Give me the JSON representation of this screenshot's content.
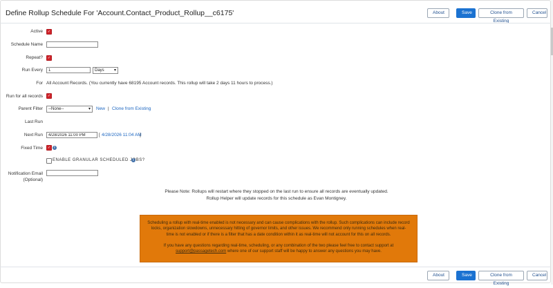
{
  "page": {
    "title": "Define Rollup Schedule For 'Account.Contact_Product_Rollup__c6175'"
  },
  "buttons": {
    "about": "About",
    "save": "Save",
    "clone": "Clone from Existing",
    "cancel": "Cancel"
  },
  "form": {
    "active_label": "Active",
    "schedule_name_label": "Schedule Name",
    "schedule_name_value": "",
    "repeat_label": "Repeat?",
    "run_every_label": "Run Every",
    "run_every_value": "1",
    "run_every_unit": "Days",
    "for_label": "For",
    "for_value": "All Account Records.  (You currently have 68195 Account records. This rollup will take 2 days 11 hours to process.)",
    "run_all_label": "Run for all records",
    "parent_filter_label": "Parent Filter",
    "parent_filter_value": "--None--",
    "parent_filter_new": "New",
    "parent_filter_divider": "|",
    "parent_filter_clone": "Clone from Existing",
    "last_run_label": "Last Run",
    "next_run_label": "Next Run",
    "next_run_value": "4/28/2026 11:00 PM",
    "next_run_bracket_open": "[",
    "next_run_link": "4/28/2026 11:04 AM",
    "next_run_bracket_close": "]",
    "fixed_time_label": "Fixed Time",
    "granular_label": "ENABLE GRANULAR SCHEDULED JOBS?",
    "notification_label_1": "Notification Email",
    "notification_label_2": "(Optional)",
    "notification_value": ""
  },
  "note": {
    "line1": "Please Note: Rollups will restart where they stopped on the last run to ensure all records are eventually updated.",
    "line2": "Rollup Helper will update records for this schedule as Evan Montigney."
  },
  "warning": {
    "para1": "Scheduling a rollup with real-time enabled is not necessary and can cause complications with the rollup. Such complications can include record locks, organization slowdowns, unnecessary hitting of governor limits, and other issues. We recommend only running schedules when real-time is not enabled or if there is a filter that has a date condition within it as real-time will not account for this on all records.",
    "para2_pre": "If you have any questions regarding real-time, scheduling, or any combination of the two please feel free to contact support at",
    "email": "support@passagetech.com",
    "para2_post": "where one of our support staff will be happy to answer any questions you may have."
  },
  "colors": {
    "primary": "#1b72d1",
    "checkbox": "#d0232a",
    "warning_bg": "#e1790a",
    "link": "#1b65c0"
  },
  "icons": [
    "checkbox-checked-icon",
    "info-icon",
    "dropdown-arrow-icon"
  ]
}
